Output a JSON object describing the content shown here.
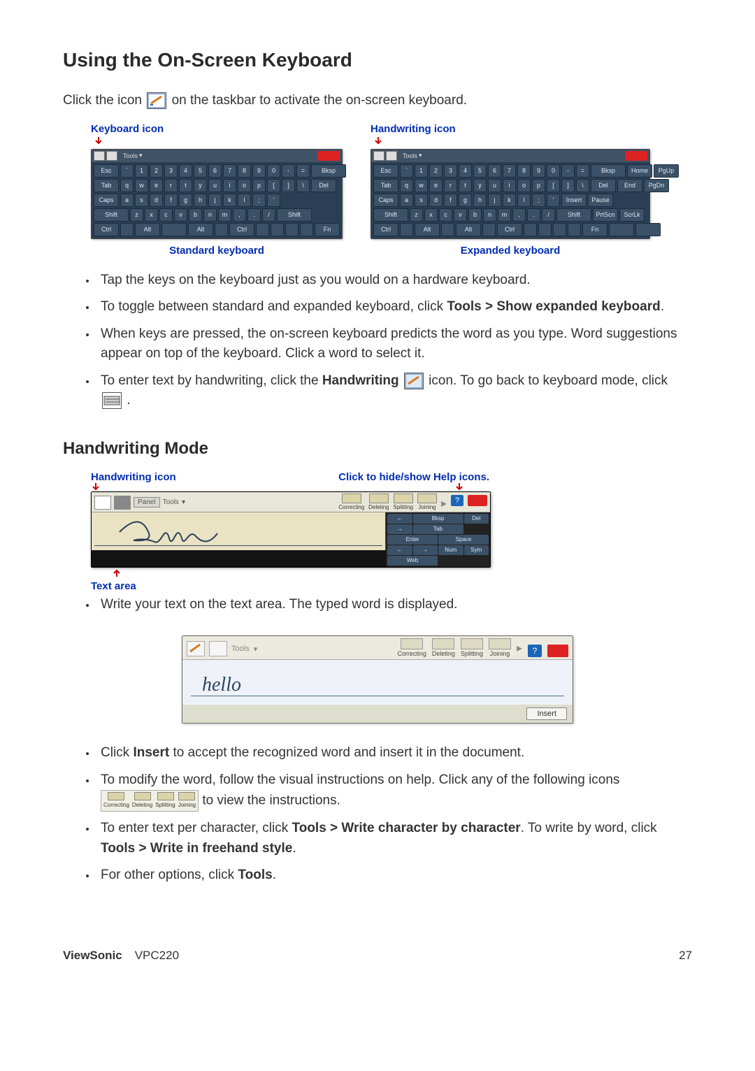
{
  "headings": {
    "h1": "Using the On-Screen Keyboard",
    "h2": "Handwriting Mode"
  },
  "intro": {
    "pre": "Click the icon ",
    "post": " on the taskbar to activate the on-screen keyboard."
  },
  "figures": {
    "kb_icon_label": "Keyboard icon",
    "hw_icon_label": "Handwriting icon",
    "standard_caption": "Standard keyboard",
    "expanded_caption": "Expanded keyboard",
    "tools_label": "Tools",
    "kb_rows": {
      "r1": [
        "Esc",
        "`",
        "1",
        "2",
        "3",
        "4",
        "5",
        "6",
        "7",
        "8",
        "9",
        "0",
        "-",
        "=",
        "Bksp"
      ],
      "r2": [
        "Tab",
        "q",
        "w",
        "e",
        "r",
        "t",
        "y",
        "u",
        "i",
        "o",
        "p",
        "[",
        "]",
        "\\",
        "Del"
      ],
      "r3": [
        "Caps",
        "a",
        "s",
        "d",
        "f",
        "g",
        "h",
        "j",
        "k",
        "l",
        ";",
        "'"
      ],
      "r4": [
        "Shift",
        "z",
        "x",
        "c",
        "v",
        "b",
        "n",
        "m",
        ",",
        ".",
        "/",
        "Shift"
      ],
      "r5": [
        "Ctrl",
        "",
        "Alt",
        "",
        "Alt",
        "",
        "Ctrl",
        "",
        "",
        "",
        "",
        "Fn"
      ]
    },
    "exp_extra": {
      "r1": [
        "Home",
        "PgUp"
      ],
      "r2": [
        "End",
        "PgDn"
      ],
      "r3": [
        "Insert",
        "Pause"
      ],
      "r4": [
        "PrtScn",
        "ScrLk"
      ],
      "r5": [
        "",
        ""
      ]
    }
  },
  "bullets1": {
    "b1": "Tap the keys on the keyboard just as you would on a hardware keyboard.",
    "b2_pre": "To toggle between standard and expanded keyboard, click ",
    "b2_bold": "Tools > Show expanded keyboard",
    "b2_post": ".",
    "b3": "When keys are pressed, the on-screen keyboard predicts the word as you type. Word suggestions appear on top of the keyboard. Click a word to select it.",
    "b4_pre": "To enter text by handwriting, click the ",
    "b4_bold": "Handwriting",
    "b4_mid": " icon. To go back to keyboard mode, click ",
    "b4_post": "."
  },
  "hwfig": {
    "hw_icon_label": "Handwriting icon",
    "hide_show_label": "Click to hide/show Help icons.",
    "text_area_label": "Text area",
    "help": {
      "c": "Correcting",
      "d": "Deleting",
      "s": "Splitting",
      "j": "Joining"
    },
    "tools": "Tools",
    "panel_label": "Panel",
    "keys": {
      "left": "←",
      "bksp": "Bksp",
      "del": "Del",
      "right": "→",
      "tab": "Tab",
      "enter": "Enter",
      "space": "Space",
      "num": "Num",
      "sym": "Sym",
      "web": "Web"
    }
  },
  "body2": {
    "b1": "Write your text on the text area. The typed word is displayed.",
    "word": "hello",
    "insert": "Insert"
  },
  "bullets2": {
    "b1_pre": "Click ",
    "b1_bold": "Insert",
    "b1_post": " to accept the recognized word and insert it in the document.",
    "b2_pre": "To modify the word, follow the visual instructions on help. Click any of the following icons ",
    "b2_post": " to view the instructions.",
    "b3_pre": "To enter text per character, click ",
    "b3_bold1": "Tools > Write character by character",
    "b3_mid": ". To write by word, click ",
    "b3_bold2": "Tools > Write in freehand style",
    "b3_post": ".",
    "b4_pre": "For other options, click ",
    "b4_bold": "Tools",
    "b4_post": "."
  },
  "footer": {
    "brand": "ViewSonic",
    "model": "VPC220",
    "page": "27"
  }
}
